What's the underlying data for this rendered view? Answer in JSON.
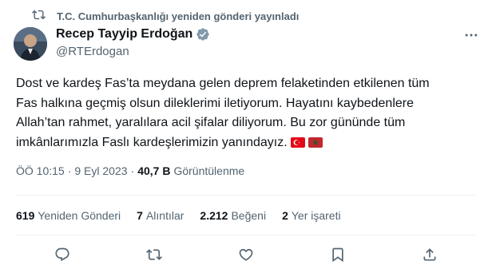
{
  "repost": {
    "label": "T.C. Cumhurbaşkanlığı yeniden gönderi yayınladı",
    "icon": "repost-icon"
  },
  "author": {
    "name": "Recep Tayyip Erdoğan",
    "handle": "@RTErdogan",
    "verified_color": "#829aab"
  },
  "tweet": {
    "lines": [
      "Dost ve kardeş Fas’ta meydana gelen deprem felaketinden etkilenen tüm",
      "Fas halkına geçmiş olsun dileklerimi iletiyorum. Hayatını kaybedenlere",
      "Allah’tan rahmet, yaralılara acil şifalar diliyorum. Bu zor gününde tüm",
      "imkânlarımızla Faslı kardeşlerimizin yanındayız."
    ],
    "flags": [
      "turkey-flag",
      "morocco-flag"
    ]
  },
  "meta": {
    "time": "ÖÖ 10:15",
    "separator": "·",
    "date": "9 Eyl 2023",
    "views_count": "40,7 B",
    "views_label": "Görüntülenme"
  },
  "stats": {
    "reposts": {
      "count": "619",
      "label": "Yeniden Gönderi"
    },
    "quotes": {
      "count": "7",
      "label": "Alıntılar"
    },
    "likes": {
      "count": "2.212",
      "label": "Beğeni"
    },
    "bookmarks": {
      "count": "2",
      "label": "Yer işareti"
    }
  },
  "actions": [
    "reply-icon",
    "repost-icon",
    "like-icon",
    "bookmark-icon",
    "share-icon"
  ],
  "colors": {
    "text": "#0f1419",
    "secondary": "#536471",
    "divider": "#eff3f4"
  }
}
